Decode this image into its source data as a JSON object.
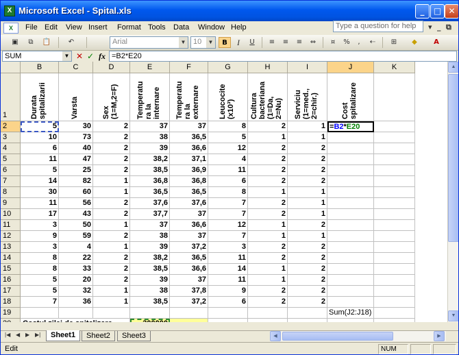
{
  "window": {
    "title": "Microsoft Excel - Spital.xls",
    "app_icon": "excel-icon"
  },
  "menu": [
    "File",
    "Edit",
    "View",
    "Insert",
    "Format",
    "Tools",
    "Data",
    "Window",
    "Help"
  ],
  "ask_placeholder": "Type a question for help",
  "toolbar": {
    "font": "Arial",
    "size": "10",
    "bold": "B",
    "italic": "I",
    "underline": "U",
    "percent": "%",
    "comma": ","
  },
  "formula": {
    "name_box": "SUM",
    "content": "=B2*E20"
  },
  "columns": [
    "B",
    "C",
    "D",
    "E",
    "F",
    "G",
    "H",
    "I",
    "J",
    "K"
  ],
  "selected_column": "J",
  "selected_row": "2",
  "headers": {
    "B": "Durata\nspitalizarii",
    "C": "Varsta",
    "D": "Sex\n(1=M,2=F)",
    "E": "Temperatu\nra la\ninternare",
    "F": "Temperatu\nra la\nexternare",
    "G": "Leucocite\n(x10³)",
    "H": "Cultura\nbacteriana\n(1=Da,\n2=Nu)",
    "I": "Serviciu\n(1=med.,\n2=chir.)",
    "J": "Cost\nspitalizare"
  },
  "rows": [
    [
      "5",
      "30",
      "2",
      "37",
      "37",
      "8",
      "2",
      "1"
    ],
    [
      "10",
      "73",
      "2",
      "38",
      "36,5",
      "5",
      "1",
      "1"
    ],
    [
      "6",
      "40",
      "2",
      "39",
      "36,6",
      "12",
      "2",
      "2"
    ],
    [
      "11",
      "47",
      "2",
      "38,2",
      "37,1",
      "4",
      "2",
      "2"
    ],
    [
      "5",
      "25",
      "2",
      "38,5",
      "36,9",
      "11",
      "2",
      "2"
    ],
    [
      "14",
      "82",
      "1",
      "36,8",
      "36,8",
      "6",
      "2",
      "2"
    ],
    [
      "30",
      "60",
      "1",
      "36,5",
      "36,5",
      "8",
      "1",
      "1"
    ],
    [
      "11",
      "56",
      "2",
      "37,6",
      "37,6",
      "7",
      "2",
      "1"
    ],
    [
      "17",
      "43",
      "2",
      "37,7",
      "37",
      "7",
      "2",
      "1"
    ],
    [
      "3",
      "50",
      "1",
      "37",
      "36,6",
      "12",
      "1",
      "2"
    ],
    [
      "9",
      "59",
      "2",
      "38",
      "37",
      "7",
      "1",
      "1"
    ],
    [
      "3",
      "4",
      "1",
      "39",
      "37,2",
      "3",
      "2",
      "2"
    ],
    [
      "8",
      "22",
      "2",
      "38,2",
      "36,5",
      "11",
      "2",
      "2"
    ],
    [
      "8",
      "33",
      "2",
      "38,5",
      "36,6",
      "14",
      "1",
      "2"
    ],
    [
      "5",
      "20",
      "2",
      "39",
      "37",
      "11",
      "1",
      "2"
    ],
    [
      "5",
      "32",
      "1",
      "38",
      "37,8",
      "9",
      "2",
      "2"
    ],
    [
      "7",
      "36",
      "1",
      "38,5",
      "37,2",
      "6",
      "2",
      "2"
    ]
  ],
  "j2_formula": {
    "eq": "=",
    "ref1": "B2",
    "op": "*",
    "ref2": "E20"
  },
  "j19_note": "Sum(J2:J18)",
  "row20": {
    "label": "Costul zilei de spitalizare",
    "value": "300000"
  },
  "row_numbers": [
    "1",
    "2",
    "3",
    "4",
    "5",
    "6",
    "7",
    "8",
    "9",
    "10",
    "11",
    "12",
    "13",
    "14",
    "15",
    "16",
    "17",
    "18",
    "19",
    "20",
    "21"
  ],
  "sheets": [
    "Sheet1",
    "Sheet2",
    "Sheet3"
  ],
  "active_sheet": "Sheet1",
  "status": {
    "mode": "Edit",
    "num": "NUM"
  },
  "colors": {
    "ref1": "#0000ff",
    "ref2": "#008000",
    "input_fill": "#ffff99",
    "selection": "#fbd48a"
  }
}
